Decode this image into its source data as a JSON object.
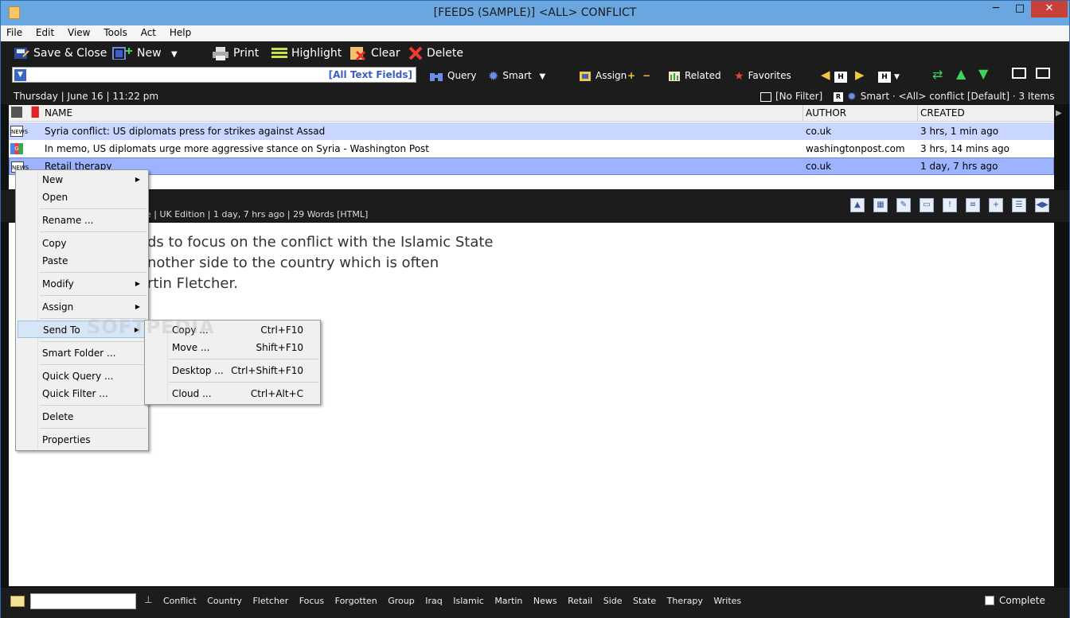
{
  "window": {
    "title": "[FEEDS (SAMPLE)]  <ALL> CONFLICT",
    "minimize_glyph": "─",
    "maximize_glyph": "□",
    "close_glyph": "✕"
  },
  "menubar": [
    "File",
    "Edit",
    "View",
    "Tools",
    "Act",
    "Help"
  ],
  "toolbar": {
    "save_close": "Save & Close",
    "new": "New",
    "print": "Print",
    "highlight": "Highlight",
    "clear": "Clear",
    "delete": "Delete"
  },
  "filterbar": {
    "all_text_fields": "[All Text Fields]",
    "query": "Query",
    "smart": "Smart",
    "assign": "Assign",
    "related": "Related",
    "favorites": "Favorites"
  },
  "daterow": {
    "date": "Thursday  |  June 16  |  11:22 pm",
    "no_filter": "[No Filter]",
    "smart_info": "Smart · <All> conflict  [Default]  ·  3 Items"
  },
  "table": {
    "columns": [
      "NAME",
      "AUTHOR",
      "CREATED"
    ],
    "rows": [
      {
        "name": "Syria conflict: US diplomats press for strikes against Assad",
        "author": "co.uk",
        "created": "3 hrs, 1 min ago",
        "icon": "news-icon"
      },
      {
        "name": "In memo, US diplomats urge more aggressive stance on Syria - Washington Post",
        "author": "washingtonpost.com",
        "created": "3 hrs, 14 mins ago",
        "icon": "google-news-icon"
      },
      {
        "name": "Retail therapy",
        "author": "co.uk",
        "created": "1 day, 7 hrs ago",
        "icon": "news-icon"
      }
    ]
  },
  "preview": {
    "meta": "e | UK Edition | 1 day, 7 hrs ago | 29 Words  [HTML]",
    "lines": [
      "ds to focus on the conflict with the Islamic State",
      "nother side to the country which is often",
      "rtin Fletcher."
    ]
  },
  "context_menu": {
    "items": [
      "New",
      "Open",
      "Rename ...",
      "Copy",
      "Paste",
      "Modify",
      "Assign",
      "Send To",
      "Smart Folder ...",
      "Quick Query ...",
      "Quick Filter ...",
      "Delete",
      "Properties"
    ]
  },
  "submenu": {
    "items": [
      {
        "label": "Copy ...",
        "shortcut": "Ctrl+F10"
      },
      {
        "label": "Move ...",
        "shortcut": "Shift+F10"
      },
      {
        "label": "Desktop ...",
        "shortcut": "Ctrl+Shift+F10"
      },
      {
        "label": "Cloud ...",
        "shortcut": "Ctrl+Alt+C"
      }
    ]
  },
  "statusbar": {
    "tags": [
      "Conflict",
      "Country",
      "Fletcher",
      "Focus",
      "Forgotten",
      "Group",
      "Iraq",
      "Islamic",
      "Martin",
      "News",
      "Retail",
      "Side",
      "State",
      "Therapy",
      "Writes"
    ],
    "complete": "Complete"
  },
  "watermark": "SOFTPEDIA"
}
